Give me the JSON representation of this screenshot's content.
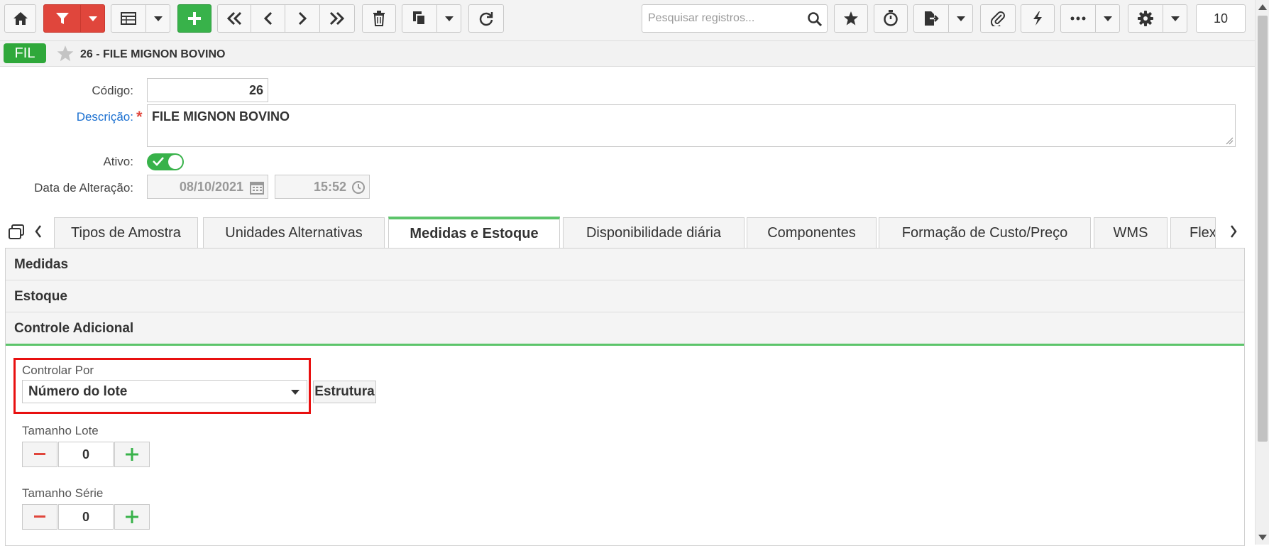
{
  "toolbar": {
    "search_placeholder": "Pesquisar registros...",
    "page_size": "10"
  },
  "record": {
    "badge": "FIL",
    "title": "26 - FILE MIGNON BOVINO"
  },
  "form": {
    "codigo_label": "Código:",
    "codigo_value": "26",
    "descricao_label": "Descrição:",
    "descricao_required_mark": "*",
    "descricao_value": "FILE MIGNON BOVINO",
    "ativo_label": "Ativo:",
    "ativo_on": true,
    "data_label": "Data de Alteração:",
    "data_value": "08/10/2021",
    "hora_value": "15:52"
  },
  "tabs": [
    {
      "label": "Tipos de Amostra"
    },
    {
      "label": "Unidades Alternativas"
    },
    {
      "label": "Medidas e Estoque",
      "active": true
    },
    {
      "label": "Disponibilidade diária"
    },
    {
      "label": "Componentes"
    },
    {
      "label": "Formação de Custo/Preço"
    },
    {
      "label": "WMS"
    },
    {
      "label": "Flex"
    }
  ],
  "sections": [
    {
      "label": "Medidas"
    },
    {
      "label": "Estoque"
    },
    {
      "label": "Controle Adicional",
      "open": true
    }
  ],
  "controle": {
    "controlar_por_label": "Controlar Por",
    "controlar_por_value": "Número do lote",
    "estrutura_label": "Estrutura",
    "tamanho_lote_label": "Tamanho Lote",
    "tamanho_lote_value": "0",
    "tamanho_serie_label": "Tamanho Série",
    "tamanho_serie_value": "0"
  },
  "colors": {
    "accent_green": "#38b24a",
    "filter_red": "#e0463c",
    "highlight_red": "#e81010",
    "label_blue": "#1a6fd0"
  }
}
